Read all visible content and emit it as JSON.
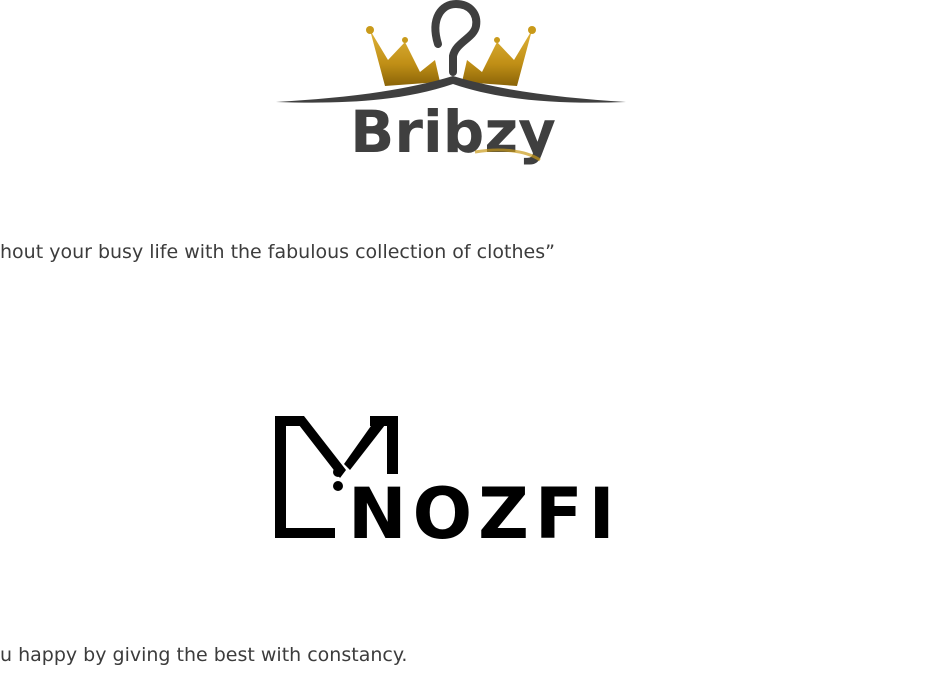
{
  "brands": [
    {
      "name": "Bribzy",
      "tagline": "hout your busy life with the fabulous collection of clothes”",
      "colors": {
        "gold": "#c99a1a",
        "dark": "#3f3f3f"
      },
      "icon": "crown-hanger-icon"
    },
    {
      "name": "MNOZFI",
      "tagline": "u happy by giving the best with constancy.",
      "colors": {
        "black": "#000000"
      },
      "icon": "m-monogram-icon"
    }
  ]
}
